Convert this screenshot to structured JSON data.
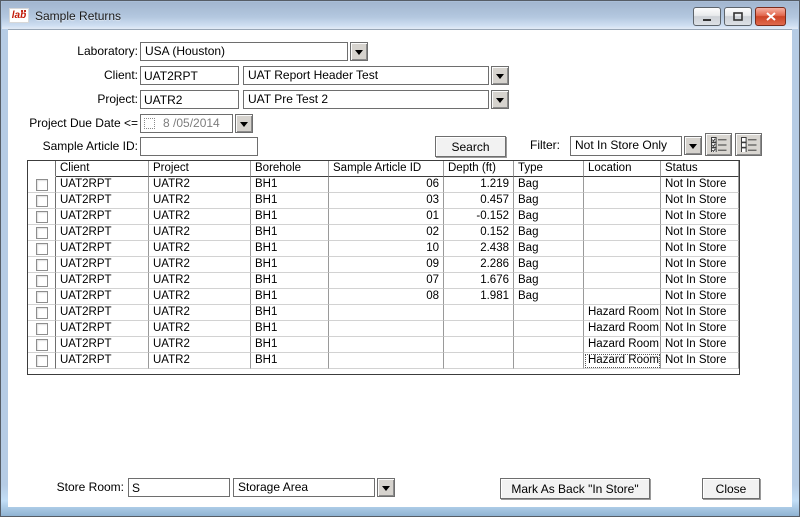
{
  "window": {
    "title": "Sample Returns",
    "icon_text": "lab"
  },
  "form": {
    "laboratory_label": "Laboratory:",
    "laboratory_value": "USA (Houston)",
    "client_label": "Client:",
    "client_code": "UAT2RPT",
    "client_name": "UAT Report Header Test",
    "project_label": "Project:",
    "project_code": "UATR2",
    "project_name": "UAT Pre Test 2",
    "due_date_label": "Project Due Date <=",
    "due_date_value": "8 /05/2014",
    "due_date_checked": false,
    "sample_article_id_label": "Sample Article ID:",
    "sample_article_id_value": "",
    "search_label": "Search",
    "filter_label": "Filter:",
    "filter_value": "Not In Store Only"
  },
  "table": {
    "columns": [
      "Client",
      "Project",
      "Borehole",
      "Sample Article ID",
      "Depth (ft)",
      "Type",
      "Location",
      "Status"
    ],
    "column_keys": [
      "client",
      "project",
      "borehole",
      "sample-article-id",
      "depth",
      "type",
      "location",
      "status"
    ],
    "right_aligned_columns": [
      3,
      4
    ],
    "focus": {
      "row_index": 11,
      "column_index": 6
    },
    "rows": [
      [
        "UAT2RPT",
        "UATR2",
        "BH1",
        "06",
        "1.219",
        "Bag",
        "",
        "Not In Store"
      ],
      [
        "UAT2RPT",
        "UATR2",
        "BH1",
        "03",
        "0.457",
        "Bag",
        "",
        "Not In Store"
      ],
      [
        "UAT2RPT",
        "UATR2",
        "BH1",
        "01",
        "-0.152",
        "Bag",
        "",
        "Not In Store"
      ],
      [
        "UAT2RPT",
        "UATR2",
        "BH1",
        "02",
        "0.152",
        "Bag",
        "",
        "Not In Store"
      ],
      [
        "UAT2RPT",
        "UATR2",
        "BH1",
        "10",
        "2.438",
        "Bag",
        "",
        "Not In Store"
      ],
      [
        "UAT2RPT",
        "UATR2",
        "BH1",
        "09",
        "2.286",
        "Bag",
        "",
        "Not In Store"
      ],
      [
        "UAT2RPT",
        "UATR2",
        "BH1",
        "07",
        "1.676",
        "Bag",
        "",
        "Not In Store"
      ],
      [
        "UAT2RPT",
        "UATR2",
        "BH1",
        "08",
        "1.981",
        "Bag",
        "",
        "Not In Store"
      ],
      [
        "UAT2RPT",
        "UATR2",
        "BH1",
        "",
        "",
        "",
        "Hazard Room",
        "Not In Store"
      ],
      [
        "UAT2RPT",
        "UATR2",
        "BH1",
        "",
        "",
        "",
        "Hazard Room",
        "Not In Store"
      ],
      [
        "UAT2RPT",
        "UATR2",
        "BH1",
        "",
        "",
        "",
        "Hazard Room",
        "Not In Store"
      ],
      [
        "UAT2RPT",
        "UATR2",
        "BH1",
        "",
        "",
        "",
        "Hazard Room",
        "Not In Store"
      ]
    ]
  },
  "footer": {
    "store_room_label": "Store Room:",
    "store_room_code": "S",
    "store_room_name": "Storage Area",
    "mark_label": "Mark As Back \"In Store\"",
    "close_label": "Close"
  }
}
